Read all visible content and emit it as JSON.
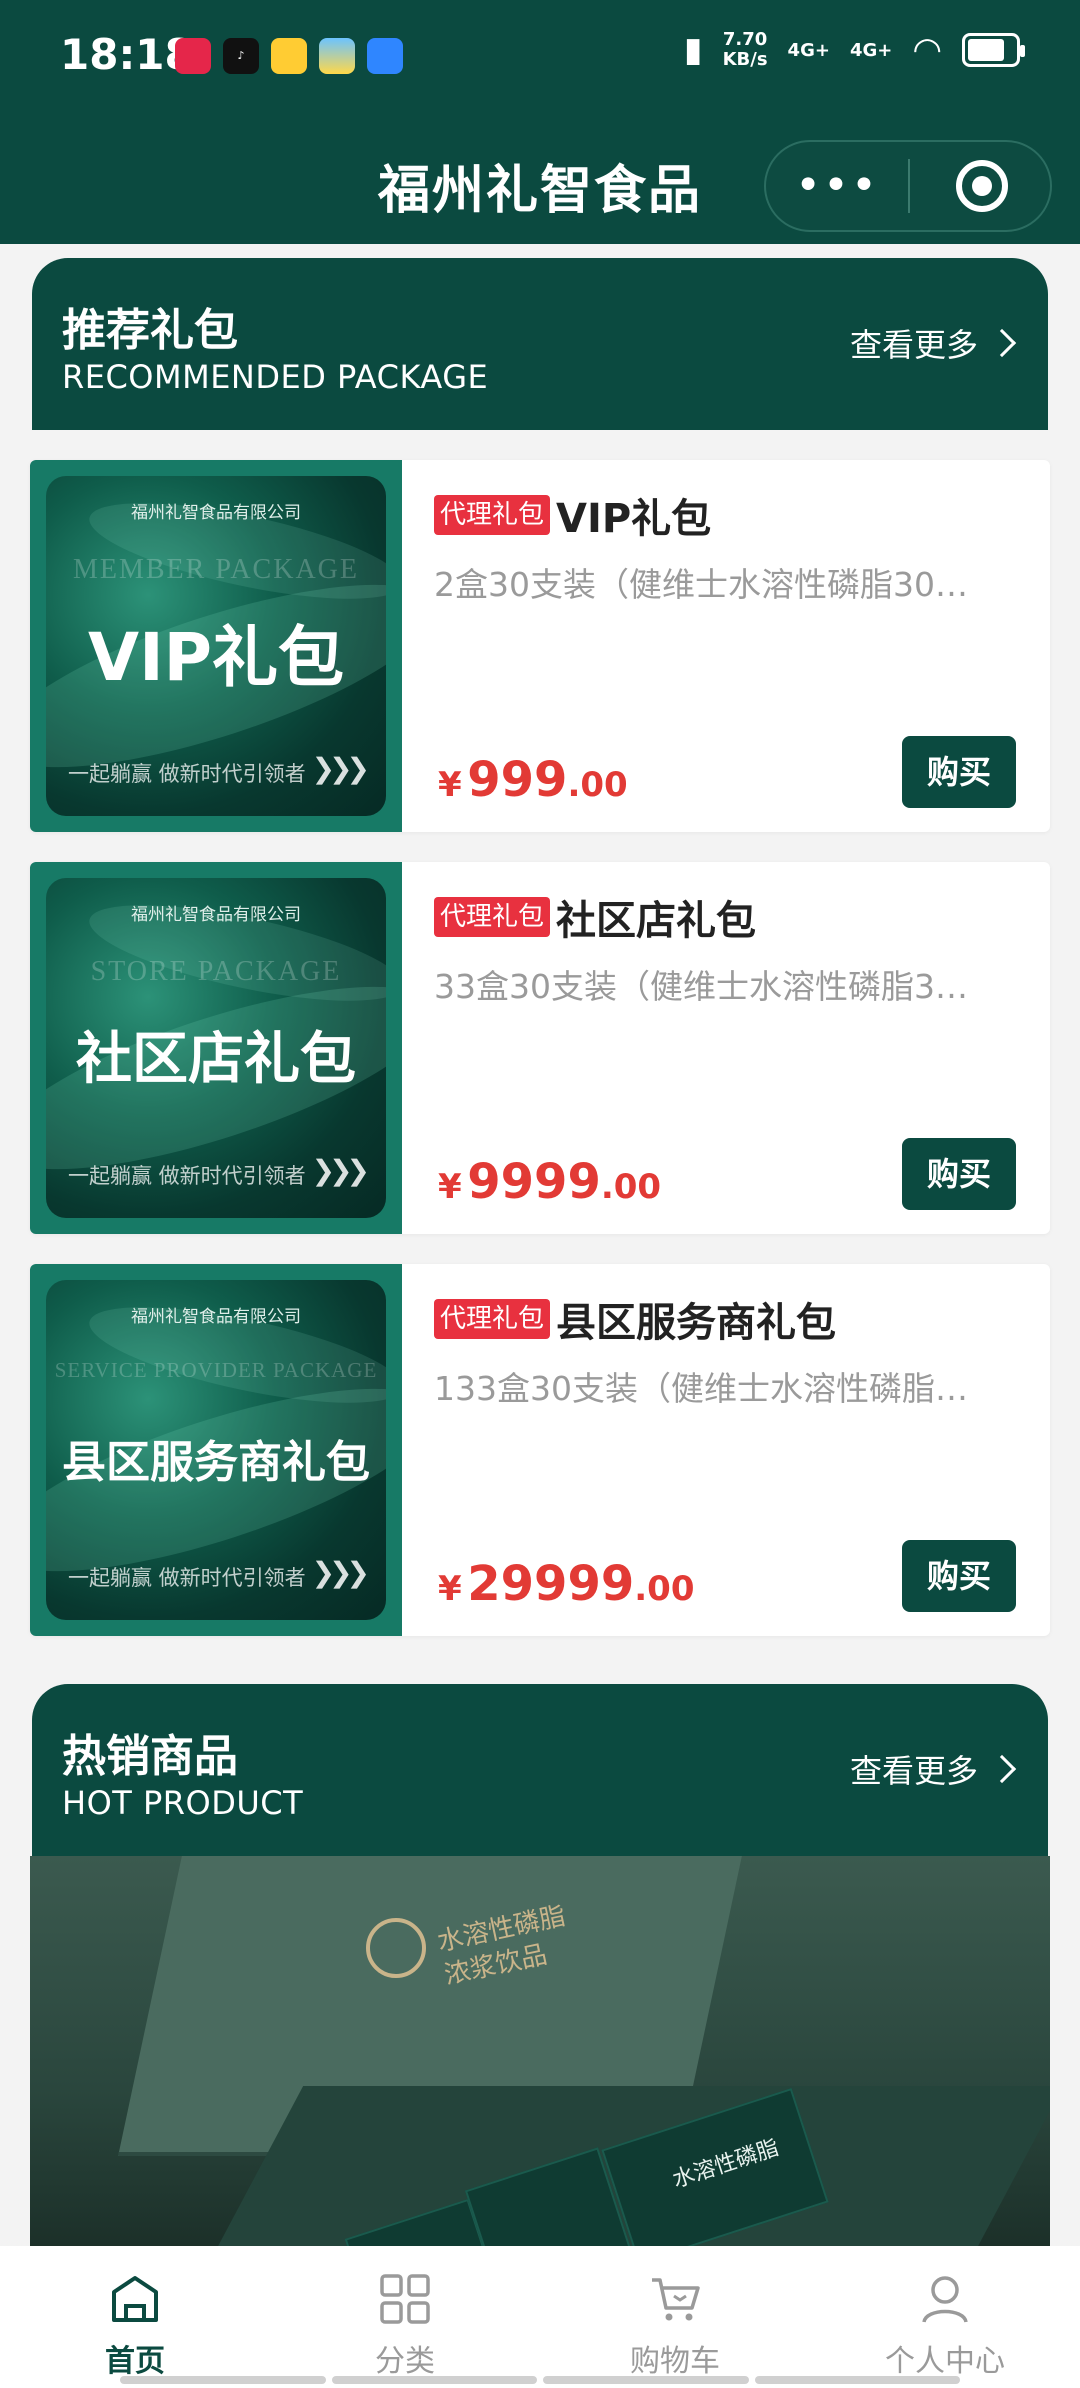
{
  "status_bar": {
    "time": "18:18",
    "speed_value": "7.70",
    "speed_unit": "KB/s",
    "net1": "4G+",
    "net2": "4G+"
  },
  "header": {
    "title": "福州礼智食品"
  },
  "recommended": {
    "title": "推荐礼包",
    "subtitle": "RECOMMENDED PACKAGE",
    "more": "查看更多",
    "items": [
      {
        "img_company": "福州礼智食品有限公司",
        "img_en": "MEMBER PACKAGE",
        "img_big": "VIP礼包",
        "img_slogan": "一起躺赢 做新时代引领者",
        "tag": "代理礼包",
        "name": "VIP礼包",
        "desc": "2盒30支装（健维士水溶性磷脂30…",
        "price_symbol": "¥",
        "price_int": "999",
        "price_dec": ".00",
        "buy": "购买"
      },
      {
        "img_company": "福州礼智食品有限公司",
        "img_en": "STORE PACKAGE",
        "img_big": "社区店礼包",
        "img_slogan": "一起躺赢 做新时代引领者",
        "tag": "代理礼包",
        "name": "社区店礼包",
        "desc": "33盒30支装（健维士水溶性磷脂3…",
        "price_symbol": "¥",
        "price_int": "9999",
        "price_dec": ".00",
        "buy": "购买"
      },
      {
        "img_company": "福州礼智食品有限公司",
        "img_en": "SERVICE PROVIDER PACKAGE",
        "img_big": "县区服务商礼包",
        "img_slogan": "一起躺赢 做新时代引领者",
        "tag": "代理礼包",
        "name": "县区服务商礼包",
        "desc": "133盒30支装（健维士水溶性磷脂…",
        "price_symbol": "¥",
        "price_int": "29999",
        "price_dec": ".00",
        "buy": "购买"
      }
    ]
  },
  "hot": {
    "title": "热销商品",
    "subtitle": "HOT PRODUCT",
    "more": "查看更多",
    "box_text_1": "水溶性磷脂",
    "box_text_2": "浓浆饮品",
    "stick_text": "水溶性磷脂"
  },
  "tabbar": {
    "home": "首页",
    "category": "分类",
    "cart": "购物车",
    "profile": "个人中心"
  },
  "colors": {
    "brand": "#0b4a40",
    "price": "#e23a35",
    "tag": "#e8313f"
  }
}
